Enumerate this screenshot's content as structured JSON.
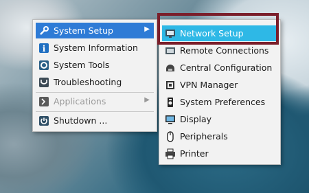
{
  "main_menu": {
    "items": [
      {
        "label": "System Setup",
        "icon": "wrench-icon",
        "has_submenu": true,
        "state": "selected"
      },
      {
        "label": "System Information",
        "icon": "info-icon",
        "has_submenu": false,
        "state": "normal"
      },
      {
        "label": "System Tools",
        "icon": "gear-icon",
        "has_submenu": false,
        "state": "normal"
      },
      {
        "label": "Troubleshooting",
        "icon": "stethoscope-icon",
        "has_submenu": false,
        "state": "normal"
      },
      {
        "label": "Applications",
        "icon": "applications-icon",
        "has_submenu": true,
        "state": "disabled"
      },
      {
        "label": "Shutdown ...",
        "icon": "power-icon",
        "has_submenu": false,
        "state": "normal"
      }
    ]
  },
  "sub_menu": {
    "items": [
      {
        "label": "Network Setup",
        "icon": "network-icon",
        "state": "highlighted"
      },
      {
        "label": "Remote Connections",
        "icon": "remote-icon",
        "state": "normal"
      },
      {
        "label": "Central Configuration",
        "icon": "central-config-icon",
        "state": "normal"
      },
      {
        "label": "VPN Manager",
        "icon": "vpn-icon",
        "state": "normal"
      },
      {
        "label": "System Preferences",
        "icon": "preferences-icon",
        "state": "normal"
      },
      {
        "label": "Display",
        "icon": "display-icon",
        "state": "normal"
      },
      {
        "label": "Peripherals",
        "icon": "mouse-icon",
        "state": "normal"
      },
      {
        "label": "Printer",
        "icon": "printer-icon",
        "state": "normal"
      }
    ]
  },
  "colors": {
    "menu_selected": "#2e7bd6",
    "submenu_highlight": "#2eb8e6",
    "focus_outline": "#7a1e2a"
  }
}
